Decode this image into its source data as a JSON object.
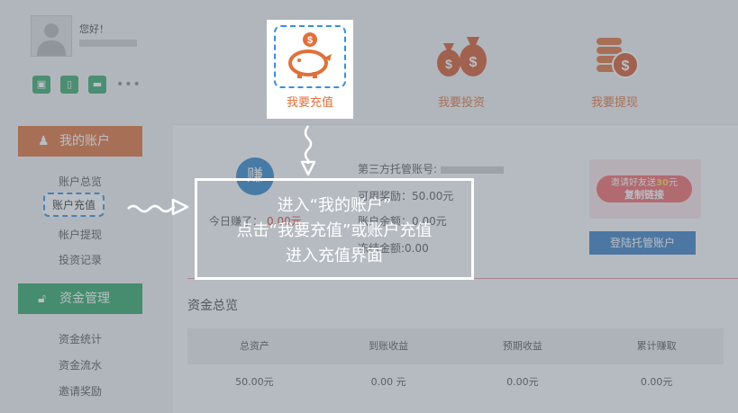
{
  "profile": {
    "greeting": "您好！",
    "quick_icons": [
      "id-card-icon",
      "phone-icon",
      "bank-card-icon",
      "more-icon"
    ]
  },
  "sidebar": {
    "account_header": "我的账户",
    "account_items": [
      "账户总览",
      "账户充值",
      "帐户提现",
      "投资记录"
    ],
    "funds_header": "资金管理",
    "funds_items": [
      "资金统计",
      "资金流水",
      "邀请奖励"
    ]
  },
  "actions": {
    "recharge": "我要充值",
    "invest": "我要投资",
    "withdraw": "我要提现"
  },
  "account_panel": {
    "earn_badge": "赚",
    "today_earned_label": "今日赚了：",
    "today_earned_value": "0.00元",
    "trust_account_label": "第三方托管账号:",
    "reward": "可用奖励：50.00元",
    "balance": "账户余额：0.00元",
    "frozen": "冻结金额:0.00",
    "invite_banner": {
      "line1_prefix": "邀请好友送",
      "line1_amount": "30",
      "line1_suffix": "元",
      "line2": "复制链接"
    },
    "login_trust_button": "登陆托管账户"
  },
  "overview": {
    "title": "资金总览",
    "headers": [
      "总资产",
      "到账收益",
      "预期收益",
      "累计赚取"
    ],
    "values": [
      "50.00元",
      "0.00 元",
      "0.00元",
      "0.00元"
    ]
  },
  "callout": {
    "lines": [
      "进入“我的账户”",
      "点击“我要充值”或账户充值",
      "进入充值界面"
    ]
  },
  "colors": {
    "orange": "#e0703a",
    "green": "#2fa463",
    "blue_dashed": "#3a8edb",
    "button_blue": "#3a7fc1"
  }
}
